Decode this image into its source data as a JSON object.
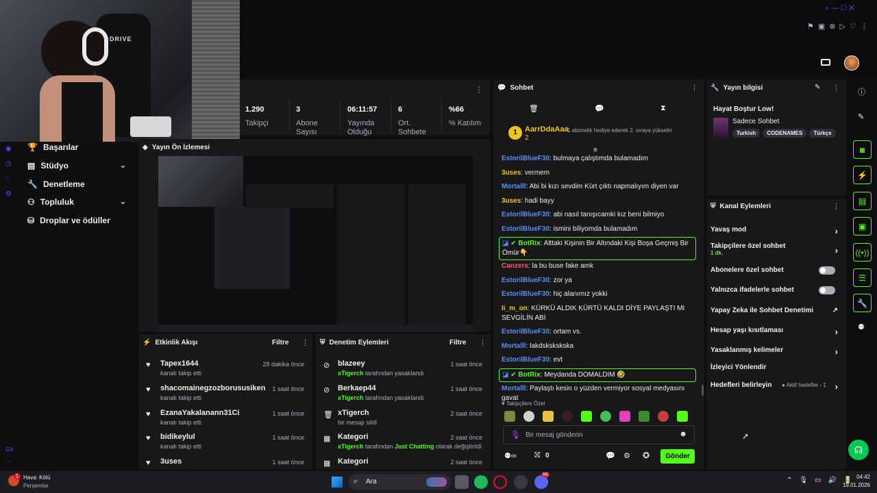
{
  "stats": [
    {
      "value": "1.290",
      "label": "Takipçi"
    },
    {
      "value": "3",
      "label": "Abone Sayısı"
    },
    {
      "value": "06:11:57",
      "label": "Yayında Olduğu"
    },
    {
      "value": "6",
      "label": "Ort. Sohbete"
    },
    {
      "value": "%66",
      "label": "% Katılım"
    }
  ],
  "nav": {
    "items": [
      {
        "label": "Başarılar"
      },
      {
        "label": "Stüdyo"
      },
      {
        "label": "Denetleme"
      },
      {
        "label": "Topluluk"
      },
      {
        "label": "Droplar ve ödüller"
      }
    ],
    "gx_label": "GX"
  },
  "preview": {
    "title": "Yayın Ön İzlemesi"
  },
  "activity": {
    "title": "Etkinlik Akışı",
    "filter": "Filtre",
    "rows": [
      {
        "name": "Tapex1644",
        "sub": "kanalı takip etti",
        "time": "28 dakika önce"
      },
      {
        "name": "shacomainegzozborususiken",
        "sub": "kanalı takip etti",
        "time": "1 saat önce"
      },
      {
        "name": "EzanaYakalanann31Ci",
        "sub": "kanalı takip etti",
        "time": "1 saat önce"
      },
      {
        "name": "bidikeylul",
        "sub": "kanalı takip etti",
        "time": "1 saat önce"
      },
      {
        "name": "3uses",
        "sub": "",
        "time": "1 saat önce"
      }
    ]
  },
  "moderation": {
    "title": "Denetim Eylemleri",
    "filter": "Filtre",
    "rows": [
      {
        "name": "blazeey",
        "actor": "xTigerch",
        "sub": "tarafından yasaklandı",
        "time": "1 saat önce"
      },
      {
        "name": "Berkaep44",
        "actor": "xTigerch",
        "sub": "tarafından yasaklandı",
        "time": "1 saat önce"
      },
      {
        "name": "xTigerch",
        "actor": "",
        "sub": "bir mesajı sildi",
        "time": "2 saat önce"
      },
      {
        "name": "Kategori",
        "actor": "xTigerch",
        "sub": "tarafından",
        "highlight": "Just Chatting",
        "sub2": "olarak değiştirildi",
        "time": "2 saat önce"
      },
      {
        "name": "Kategori",
        "actor": "",
        "sub": "",
        "time": "2 saat önce"
      }
    ]
  },
  "chat": {
    "title": "Sohbet",
    "pinned_user": "AarrDdaAaa",
    "pinned_count": "2",
    "pinned_text": "1 abonelik hediye ederek 2. sıraya yükselin",
    "messages": [
      {
        "user": "EstorilBlueF30",
        "color": "#5a8ff6",
        "text": "bulmaya çalıştımda bulamadım"
      },
      {
        "user": "3uses",
        "color": "#f0c419",
        "text": "vermem"
      },
      {
        "user": "Mortalll",
        "color": "#5a8ff6",
        "text": "Abi bi kızı sevdim Kürt çıktı napmalıyım diyen var"
      },
      {
        "user": "3uses",
        "color": "#f0c419",
        "text": "hadi bayy"
      },
      {
        "user": "EstorilBlueF30",
        "color": "#5a8ff6",
        "text": "abi nasıl tanışıcamki kız beni bilmiyo"
      },
      {
        "user": "EstorilBlueF30",
        "color": "#5a8ff6",
        "text": "ismini biliyomda bulamadım"
      }
    ],
    "bot1": {
      "user": "BotRix",
      "text": "Alttaki Kişinin Bir Altındaki Kişi Boşa Geçmiş Bir Ömür👇"
    },
    "messages2": [
      {
        "user": "Canzers",
        "color": "#ff5a6e",
        "text": "la bu buse fake amk"
      },
      {
        "user": "EstorilBlueF30",
        "color": "#5a8ff6",
        "text": "zor ya"
      },
      {
        "user": "EstorilBlueF30",
        "color": "#5a8ff6",
        "text": "hiç alanımız yokki"
      },
      {
        "user": "Ii_m_on",
        "color": "#f0c419",
        "text": "KÜRKÜ ALDIK KÜRTÜ KALDI DİYE PAYLAŞTI MI SEVGİLİN ABİ"
      },
      {
        "user": "EstorilBlueF30",
        "color": "#5a8ff6",
        "text": "ortam vs."
      },
      {
        "user": "Mortalll",
        "color": "#5a8ff6",
        "text": "lakdskskskska"
      },
      {
        "user": "EstorilBlueF30",
        "color": "#5a8ff6",
        "text": "evt"
      }
    ],
    "bot2": {
      "user": "BotRix",
      "text": "Meydanda DOMALDIM 🤣"
    },
    "last": {
      "user": "Mortalll",
      "color": "#5a8ff6",
      "text": "Paylaştı kesin o yüzden vermiyor sosyal medyasını gavat"
    },
    "followers_only": "Takipçilere Özel",
    "input_placeholder": "Bir mesaj gönderin",
    "count": "0",
    "send": "Gönder"
  },
  "info": {
    "title": "Yayın bilgisi",
    "stream_title": "Hayat Boştur Low!",
    "category": "Sadece Sohbet",
    "tags": [
      "Turkish",
      "CODENAMES",
      "Türkçe"
    ]
  },
  "actions": {
    "title": "Kanal Eylemleri",
    "items": [
      {
        "label": "Yavaş mod"
      },
      {
        "label": "Takipçilere özel sohbet",
        "sub": "1 dk."
      },
      {
        "label": "Abonelere özel sohbet"
      },
      {
        "label": "Yalnızca ifadelerle sohbet"
      },
      {
        "label": "Yapay Zeka ile Sohbet Denetimi"
      },
      {
        "label": "Hesap yaşı kısıtlaması"
      },
      {
        "label": "Yasaklanmış kelimeler"
      },
      {
        "label": "İzleyici Yönlendir"
      },
      {
        "label": "Hedefleri belirleyin",
        "sub": "Aktif hedefler - 1"
      }
    ]
  },
  "taskbar": {
    "weather_label": "Hava: Kötü",
    "weather_day": "Perşembe",
    "weather_badge": "1",
    "search": "Ara",
    "time": "04:42",
    "date": "19.01.2026",
    "discord_badge": "99"
  },
  "webcam": {
    "chair_text": "DRIVE"
  }
}
